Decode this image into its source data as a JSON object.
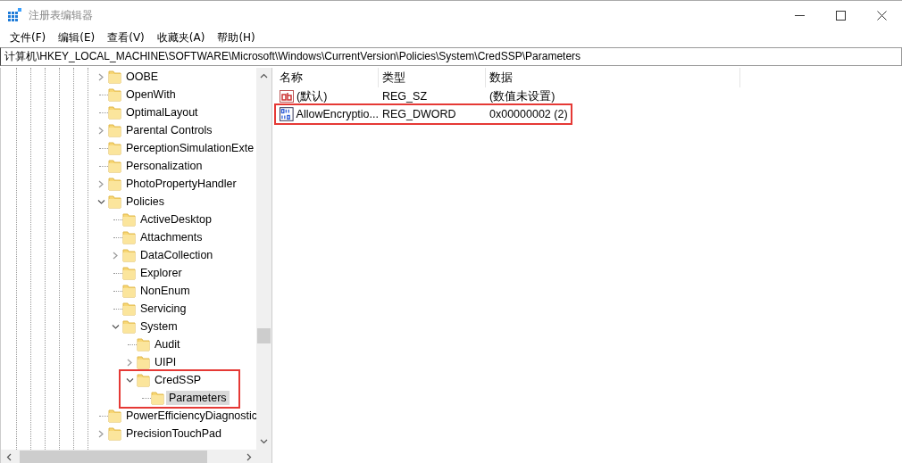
{
  "window": {
    "title": "注册表编辑器"
  },
  "menu": [
    "文件(F)",
    "编辑(E)",
    "查看(V)",
    "收藏夹(A)",
    "帮助(H)"
  ],
  "address": "计算机\\HKEY_LOCAL_MACHINE\\SOFTWARE\\Microsoft\\Windows\\CurrentVersion\\Policies\\System\\CredSSP\\Parameters",
  "tree": [
    {
      "label": "OOBE",
      "has_children": true,
      "expanded": false,
      "selected": false,
      "highlight": false
    },
    {
      "label": "OpenWith",
      "has_children": false,
      "selected": false,
      "highlight": false
    },
    {
      "label": "OptimalLayout",
      "has_children": false,
      "selected": false,
      "highlight": false
    },
    {
      "label": "Parental Controls",
      "has_children": true,
      "expanded": false,
      "selected": false,
      "highlight": false
    },
    {
      "label": "PerceptionSimulationExte",
      "has_children": false,
      "selected": false,
      "highlight": false
    },
    {
      "label": "Personalization",
      "has_children": false,
      "selected": false,
      "highlight": false
    },
    {
      "label": "PhotoPropertyHandler",
      "has_children": true,
      "expanded": false,
      "selected": false,
      "highlight": false
    },
    {
      "label": "Policies",
      "has_children": true,
      "expanded": true,
      "selected": false,
      "highlight": false,
      "children": [
        {
          "label": "ActiveDesktop",
          "has_children": false,
          "selected": false,
          "highlight": false
        },
        {
          "label": "Attachments",
          "has_children": false,
          "selected": false,
          "highlight": false
        },
        {
          "label": "DataCollection",
          "has_children": true,
          "expanded": false,
          "selected": false,
          "highlight": false
        },
        {
          "label": "Explorer",
          "has_children": false,
          "selected": false,
          "highlight": false
        },
        {
          "label": "NonEnum",
          "has_children": false,
          "selected": false,
          "highlight": false
        },
        {
          "label": "Servicing",
          "has_children": false,
          "selected": false,
          "highlight": false
        },
        {
          "label": "System",
          "has_children": true,
          "expanded": true,
          "selected": false,
          "highlight": false,
          "children": [
            {
              "label": "Audit",
              "has_children": false,
              "selected": false,
              "highlight": false
            },
            {
              "label": "UIPI",
              "has_children": true,
              "expanded": false,
              "selected": false,
              "highlight": false
            },
            {
              "label": "CredSSP",
              "has_children": true,
              "expanded": true,
              "selected": false,
              "highlight": true,
              "children": [
                {
                  "label": "Parameters",
                  "has_children": false,
                  "selected": true,
                  "highlight": false
                }
              ]
            }
          ]
        }
      ]
    },
    {
      "label": "PowerEfficiencyDiagnostic",
      "has_children": false,
      "selected": false,
      "highlight": false
    },
    {
      "label": "PrecisionTouchPad",
      "has_children": true,
      "expanded": false,
      "selected": false,
      "highlight": false
    }
  ],
  "columns": [
    "名称",
    "类型",
    "数据"
  ],
  "values": [
    {
      "kind": "string",
      "name": "(默认)",
      "type": "REG_SZ",
      "data": "(数值未设置)",
      "highlight": false
    },
    {
      "kind": "binary",
      "name": "AllowEncryptio...",
      "type": "REG_DWORD",
      "data": "0x00000002 (2)",
      "highlight": true
    }
  ]
}
